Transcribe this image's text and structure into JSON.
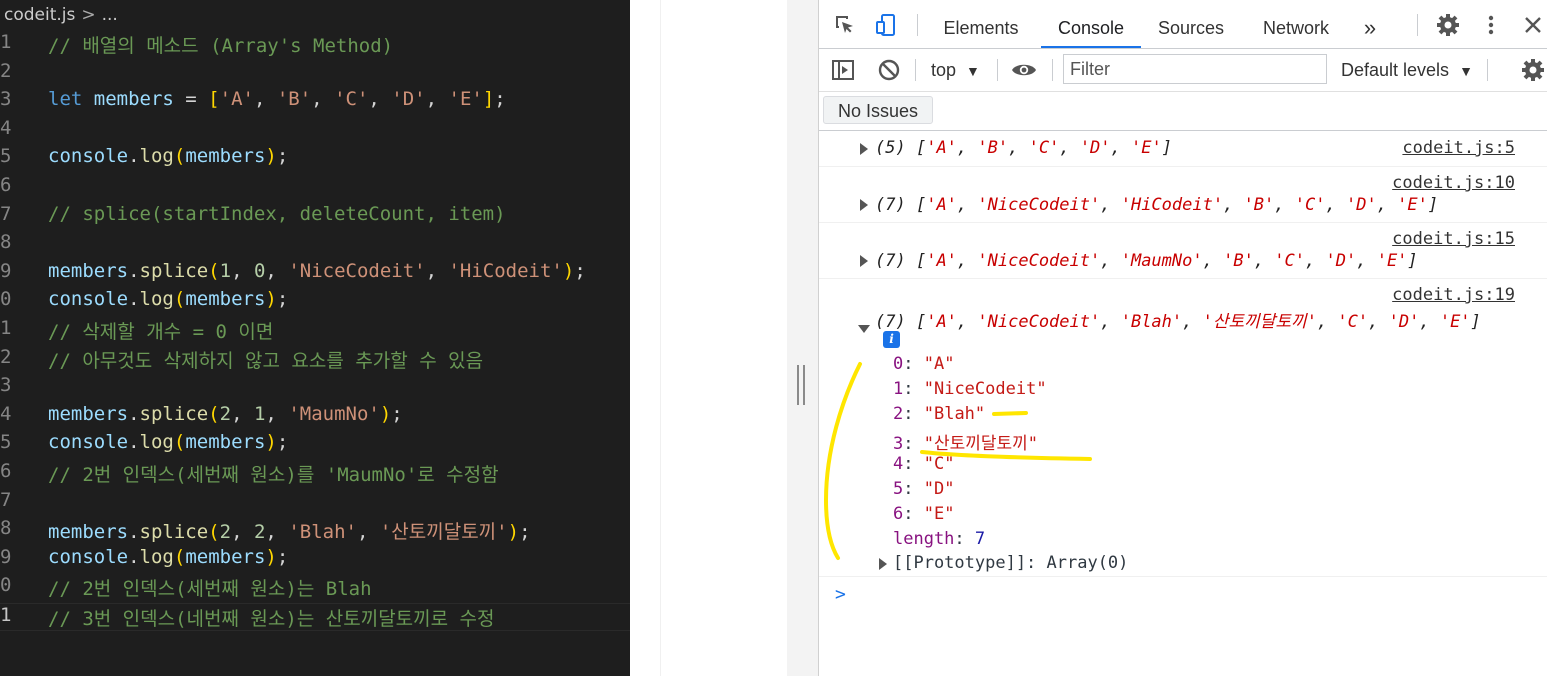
{
  "editor": {
    "breadcrumb_file": "codeit.js",
    "breadcrumb_sep": ">",
    "breadcrumb_more": "...",
    "line_numbers": [
      "1",
      "2",
      "3",
      "4",
      "5",
      "6",
      "7",
      "8",
      "9",
      "0",
      "1",
      "2",
      "3",
      "4",
      "5",
      "6",
      "7",
      "8",
      "9",
      "0",
      "1"
    ],
    "lines": [
      [
        {
          "t": "c",
          "v": "// 배열의 메소드 (Array's Method)"
        }
      ],
      [],
      [
        {
          "t": "k",
          "v": "let "
        },
        {
          "t": "v",
          "v": "members"
        },
        {
          "t": "p",
          "v": " = "
        },
        {
          "t": "b1",
          "v": "["
        },
        {
          "t": "s",
          "v": "'A'"
        },
        {
          "t": "p",
          "v": ", "
        },
        {
          "t": "s",
          "v": "'B'"
        },
        {
          "t": "p",
          "v": ", "
        },
        {
          "t": "s",
          "v": "'C'"
        },
        {
          "t": "p",
          "v": ", "
        },
        {
          "t": "s",
          "v": "'D'"
        },
        {
          "t": "p",
          "v": ", "
        },
        {
          "t": "s",
          "v": "'E'"
        },
        {
          "t": "b1",
          "v": "]"
        },
        {
          "t": "p",
          "v": ";"
        }
      ],
      [],
      [
        {
          "t": "v",
          "v": "console"
        },
        {
          "t": "p",
          "v": "."
        },
        {
          "t": "f",
          "v": "log"
        },
        {
          "t": "b1",
          "v": "("
        },
        {
          "t": "v",
          "v": "members"
        },
        {
          "t": "b1",
          "v": ")"
        },
        {
          "t": "p",
          "v": ";"
        }
      ],
      [],
      [
        {
          "t": "c",
          "v": "// splice(startIndex, deleteCount, item)"
        }
      ],
      [],
      [
        {
          "t": "v",
          "v": "members"
        },
        {
          "t": "p",
          "v": "."
        },
        {
          "t": "f",
          "v": "splice"
        },
        {
          "t": "b1",
          "v": "("
        },
        {
          "t": "n",
          "v": "1"
        },
        {
          "t": "p",
          "v": ", "
        },
        {
          "t": "n",
          "v": "0"
        },
        {
          "t": "p",
          "v": ", "
        },
        {
          "t": "s",
          "v": "'NiceCodeit'"
        },
        {
          "t": "p",
          "v": ", "
        },
        {
          "t": "s",
          "v": "'HiCodeit'"
        },
        {
          "t": "b1",
          "v": ")"
        },
        {
          "t": "p",
          "v": ";"
        }
      ],
      [
        {
          "t": "v",
          "v": "console"
        },
        {
          "t": "p",
          "v": "."
        },
        {
          "t": "f",
          "v": "log"
        },
        {
          "t": "b1",
          "v": "("
        },
        {
          "t": "v",
          "v": "members"
        },
        {
          "t": "b1",
          "v": ")"
        },
        {
          "t": "p",
          "v": ";"
        }
      ],
      [
        {
          "t": "c",
          "v": "// 삭제할 개수 = 0 이면"
        }
      ],
      [
        {
          "t": "c",
          "v": "// 아무것도 삭제하지 않고 요소를 추가할 수 있음"
        }
      ],
      [],
      [
        {
          "t": "v",
          "v": "members"
        },
        {
          "t": "p",
          "v": "."
        },
        {
          "t": "f",
          "v": "splice"
        },
        {
          "t": "b1",
          "v": "("
        },
        {
          "t": "n",
          "v": "2"
        },
        {
          "t": "p",
          "v": ", "
        },
        {
          "t": "n",
          "v": "1"
        },
        {
          "t": "p",
          "v": ", "
        },
        {
          "t": "s",
          "v": "'MaumNo'"
        },
        {
          "t": "b1",
          "v": ")"
        },
        {
          "t": "p",
          "v": ";"
        }
      ],
      [
        {
          "t": "v",
          "v": "console"
        },
        {
          "t": "p",
          "v": "."
        },
        {
          "t": "f",
          "v": "log"
        },
        {
          "t": "b1",
          "v": "("
        },
        {
          "t": "v",
          "v": "members"
        },
        {
          "t": "b1",
          "v": ")"
        },
        {
          "t": "p",
          "v": ";"
        }
      ],
      [
        {
          "t": "c",
          "v": "// 2번 인덱스(세번째 원소)를 'MaumNo'로 수정함"
        }
      ],
      [],
      [
        {
          "t": "v",
          "v": "members"
        },
        {
          "t": "p",
          "v": "."
        },
        {
          "t": "f",
          "v": "splice"
        },
        {
          "t": "b1",
          "v": "("
        },
        {
          "t": "n",
          "v": "2"
        },
        {
          "t": "p",
          "v": ", "
        },
        {
          "t": "n",
          "v": "2"
        },
        {
          "t": "p",
          "v": ", "
        },
        {
          "t": "s",
          "v": "'Blah'"
        },
        {
          "t": "p",
          "v": ", "
        },
        {
          "t": "s",
          "v": "'산토끼달토끼'"
        },
        {
          "t": "b1",
          "v": ")"
        },
        {
          "t": "p",
          "v": ";"
        }
      ],
      [
        {
          "t": "v",
          "v": "console"
        },
        {
          "t": "p",
          "v": "."
        },
        {
          "t": "f",
          "v": "log"
        },
        {
          "t": "b1",
          "v": "("
        },
        {
          "t": "v",
          "v": "members"
        },
        {
          "t": "b1",
          "v": ")"
        },
        {
          "t": "p",
          "v": ";"
        }
      ],
      [
        {
          "t": "c",
          "v": "// 2번 인덱스(세번째 원소)는 Blah"
        }
      ],
      [
        {
          "t": "c",
          "v": "// 3번 인덱스(네번째 원소)는 산토끼달토끼로 수정"
        }
      ]
    ]
  },
  "devtools": {
    "tabs": [
      "Elements",
      "Console",
      "Sources",
      "Network"
    ],
    "selected_tab": "Console",
    "more_tabs": "»",
    "context": "top",
    "filter_placeholder": "Filter",
    "levels": "Default levels",
    "issues_button": "No Issues",
    "prompt_symbol": ">",
    "messages": [
      {
        "source": "codeit.js:5",
        "count": "(5)",
        "items": [
          "'A'",
          "'B'",
          "'C'",
          "'D'",
          "'E'"
        ]
      },
      {
        "source": "codeit.js:10",
        "count": "(7)",
        "items": [
          "'A'",
          "'NiceCodeit'",
          "'HiCodeit'",
          "'B'",
          "'C'",
          "'D'",
          "'E'"
        ]
      },
      {
        "source": "codeit.js:15",
        "count": "(7)",
        "items": [
          "'A'",
          "'NiceCodeit'",
          "'MaumNo'",
          "'B'",
          "'C'",
          "'D'",
          "'E'"
        ]
      },
      {
        "source": "codeit.js:19",
        "count": "(7)",
        "items": [
          "'A'",
          "'NiceCodeit'",
          "'Blah'",
          "'산토끼달토끼'",
          "'C'",
          "'D'",
          "'E'"
        ],
        "info": "i",
        "props": [
          {
            "k": "0",
            "v": "\"A\""
          },
          {
            "k": "1",
            "v": "\"NiceCodeit\""
          },
          {
            "k": "2",
            "v": "\"Blah\""
          },
          {
            "k": "3",
            "v": "\"산토끼달토끼\""
          },
          {
            "k": "4",
            "v": "\"C\""
          },
          {
            "k": "5",
            "v": "\"D\""
          },
          {
            "k": "6",
            "v": "\"E\""
          }
        ],
        "length_key": "length",
        "length_value": "7",
        "prototype": "[[Prototype]]: Array(0)"
      }
    ]
  },
  "colors": {
    "editor_bg": "#1e1e1e",
    "accent": "#1a73e8",
    "annotation": "#ffe600"
  }
}
